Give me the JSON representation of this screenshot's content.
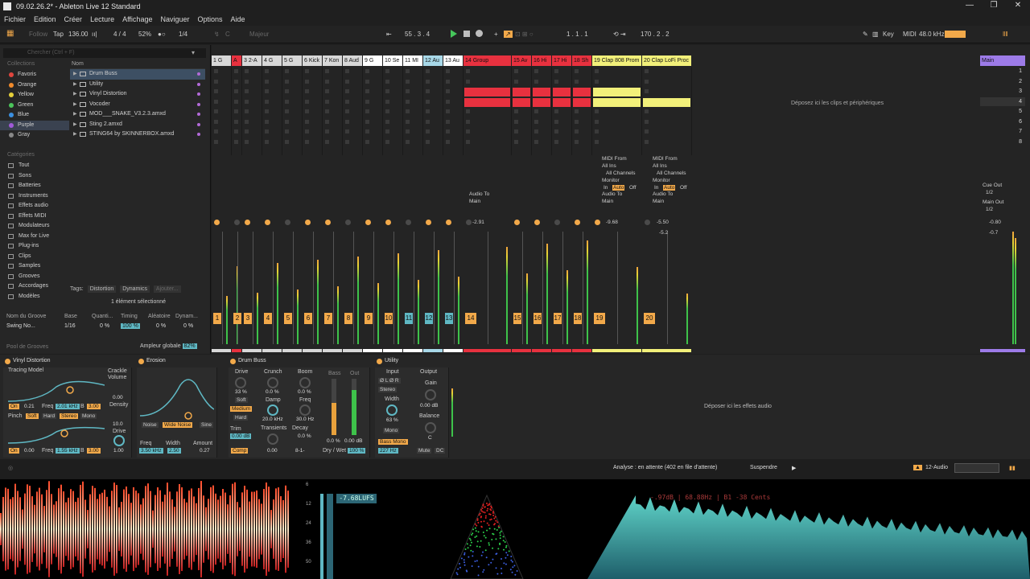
{
  "window": {
    "title": "09.02.26.2* - Ableton Live 12 Standard",
    "controls": [
      "—",
      "❐",
      "✕"
    ]
  },
  "menu": [
    "Fichier",
    "Edition",
    "Créer",
    "Lecture",
    "Affichage",
    "Naviguer",
    "Options",
    "Aide"
  ],
  "transport": {
    "follow": "Follow",
    "tap": "Tap",
    "tempo": "136.00",
    "signature": "4 / 4",
    "groove_pct": "52%",
    "quantize": "1/4",
    "key": "C",
    "scale": "Majeur",
    "position": "55 . 3 . 4",
    "loop_start": "1 . 1 . 1",
    "loop_length": "170 . 2 . 2",
    "key_label": "Key",
    "midi_label": "MIDI",
    "sample_rate": "48.0 kHz"
  },
  "browser": {
    "search_placeholder": "Chercher (Ctrl + F)",
    "collections_label": "Collections",
    "collections": [
      {
        "label": "Favoris",
        "color": "#e0463e"
      },
      {
        "label": "Orange",
        "color": "#f08a2c"
      },
      {
        "label": "Yellow",
        "color": "#e6d03a"
      },
      {
        "label": "Green",
        "color": "#4bc45a"
      },
      {
        "label": "Blue",
        "color": "#3b8fe0"
      },
      {
        "label": "Purple",
        "color": "#a05ad8"
      },
      {
        "label": "Gray",
        "color": "#888888"
      }
    ],
    "categories_label": "Catégories",
    "categories": [
      "Tout",
      "Sons",
      "Batteries",
      "Instruments",
      "Effets audio",
      "Effets MIDI",
      "Modulateurs",
      "Max for Live",
      "Plug-ins",
      "Clips",
      "Samples",
      "Grooves",
      "Accordages",
      "Modèles"
    ],
    "name_header": "Nom",
    "files": [
      "Drum Buss",
      "Utility",
      "Vinyl Distortion",
      "Vocoder",
      "MOD___SNAKE_V3.2.3.amxd",
      "Sting 2.amxd",
      "STING64 by SKINNERBOX.amxd"
    ],
    "tags_label": "Tags:",
    "tags": [
      "Distortion",
      "Dynamics",
      "Ajouter..."
    ],
    "selection_info": "1 élément sélectionné"
  },
  "groove": {
    "headers": [
      "Nom du Groove",
      "Base",
      "Quanti...",
      "Timing",
      "Aléatoire",
      "Dynam..."
    ],
    "row": [
      "Swing No...",
      "1/16",
      "0 %",
      "100 %",
      "0 %",
      "0 %"
    ],
    "pool_label": "Pool de Grooves",
    "amplitude_label": "Ampleur globale",
    "amplitude_value": "82%"
  },
  "tracks": [
    {
      "name": "1 G",
      "color": "#d8d8d8",
      "num": "1"
    },
    {
      "name": "A",
      "color": "#e8313f",
      "num": "2"
    },
    {
      "name": "3 2-A",
      "color": "#d8d8d8",
      "num": "3"
    },
    {
      "name": "4 G",
      "color": "#d8d8d8",
      "num": "4"
    },
    {
      "name": "5 G",
      "color": "#d8d8d8",
      "num": "5"
    },
    {
      "name": "6 Kick",
      "color": "#d8d8d8",
      "num": "6"
    },
    {
      "name": "7 Kon",
      "color": "#d8d8d8",
      "num": "7"
    },
    {
      "name": "8 Aud",
      "color": "#d8d8d8",
      "num": "8"
    },
    {
      "name": "9 G",
      "color": "#ffffff",
      "num": "9"
    },
    {
      "name": "10 Se",
      "color": "#ffffff",
      "num": "10"
    },
    {
      "name": "11 MI",
      "color": "#ffffff",
      "num": "11"
    },
    {
      "name": "12 Au",
      "color": "#a8d8e8",
      "num": "12"
    },
    {
      "name": "13 Au",
      "color": "#ffffff",
      "num": "13"
    },
    {
      "name": "14 Group",
      "color": "#e8313f",
      "num": "14"
    },
    {
      "name": "15 Av",
      "color": "#e8313f",
      "num": "15"
    },
    {
      "name": "16 Hi",
      "color": "#e8313f",
      "num": "16"
    },
    {
      "name": "17 Hi",
      "color": "#e8313f",
      "num": "17"
    },
    {
      "name": "18 Sh",
      "color": "#e8313f",
      "num": "18"
    },
    {
      "name": "19 Clap 808 Prom",
      "color": "#f2f07a",
      "num": "19"
    },
    {
      "name": "20 Clap LoFi Proc",
      "color": "#f2f07a",
      "num": "20"
    }
  ],
  "main_track": {
    "name": "Main",
    "color": "#9d7be8"
  },
  "scenes": [
    "1",
    "2",
    "3",
    "4",
    "5",
    "6",
    "7",
    "8"
  ],
  "session": {
    "drop_clips": "Déposez ici les clips et périphériques",
    "audio_to": "Audio To",
    "main": "Main",
    "midi_from": "MIDI From",
    "all_ins": "All Ins",
    "all_channels": "All Channels",
    "monitor": "Monitor",
    "mon_in": "In",
    "mon_auto": "Auto",
    "mon_off": "Off",
    "cue_out": "Cue Out",
    "cue_val": "1/2",
    "main_out": "Main Out",
    "main_out_val": "1/2",
    "vol_group": "-2.91",
    "vol_19": "-9.68",
    "vol_20": "-5.50",
    "pan_20": "-5.2",
    "vol_main": "-0.80",
    "pan_main": "-0.7",
    "db_scale": [
      "0",
      "6",
      "12",
      "18",
      "24",
      "30",
      "36",
      "48",
      "60"
    ]
  },
  "devices": {
    "vinyl": {
      "title": "Vinyl Distortion",
      "tracing": "Tracing Model",
      "on": "On",
      "val1": "0.21",
      "freq_label": "Freq",
      "freq": "2.01 kHz",
      "b_label": "B",
      "b_val": "3.00",
      "pinch": "Pinch",
      "soft": "Soft",
      "hard": "Hard",
      "stereo": "Stereo",
      "mono": "Mono",
      "on2": "On",
      "val2": "0.00",
      "freq2": "1.55 kHz",
      "b2": "3.00",
      "crackle": "Crackle",
      "volume": "Volume",
      "vol_val": "0.00",
      "density": "Density",
      "density_val": "10.0",
      "drive": "Drive",
      "drive_val": "1.00"
    },
    "erosion": {
      "title": "Erosion",
      "noise": "Noise",
      "wide": "Wide Noise",
      "sine": "Sine",
      "freq": "Freq",
      "freq_val": "3.50 kHz",
      "width": "Width",
      "width_val": "2.50",
      "amount": "Amount",
      "amount_val": "0.27"
    },
    "drumbuss": {
      "title": "Drum Buss",
      "drive": "Drive",
      "drive_val": "33 %",
      "soft": "Soft",
      "medium": "Medium",
      "hard": "Hard",
      "trim": "Trim",
      "trim_val": "0.00 dB",
      "comp": "Comp",
      "crunch": "Crunch",
      "crunch_val": "0.0 %",
      "damp": "Damp",
      "damp_val": "20.0 kHz",
      "transients": "Transients",
      "transients_val": "0.00",
      "boom": "Boom",
      "boom_val": "0.0 %",
      "freq": "Freq",
      "freq_val": "30.0 Hz",
      "decay": "Decay",
      "decay_val": "0.0 %",
      "bass": "Bass",
      "out": "Out",
      "bass_val": "0.0 %",
      "out_val": "0.00 dB",
      "drywet": "Dry / Wet",
      "drywet_val": "100 %",
      "rate": "8-1-"
    },
    "utility": {
      "title": "Utility",
      "input": "Input",
      "output": "Output",
      "lr": "Ø L  Ø R",
      "stereo": "Stereo",
      "width": "Width",
      "width_val": "63 %",
      "mono": "Mono",
      "bassmono": "Bass Mono",
      "bassmono_val": "227 Hz",
      "gain": "Gain",
      "gain_val": "0.00 dB",
      "balance": "Balance",
      "balance_val": "C",
      "mute": "Mute",
      "dc": "DC"
    },
    "drop_fx": "Déposer ici les effets audio"
  },
  "status": {
    "analysis": "Analyse : en attente (402 en file d'attente)",
    "suspend": "Suspendre",
    "track_sel": "12-Audio"
  },
  "visualizer": {
    "lufs": "-7.68LUFS",
    "spec_readout": "-.97dB | 68.88Hz | B1  -38 Cents",
    "db_ticks": [
      "6",
      "12",
      "24",
      "36",
      "50"
    ]
  }
}
